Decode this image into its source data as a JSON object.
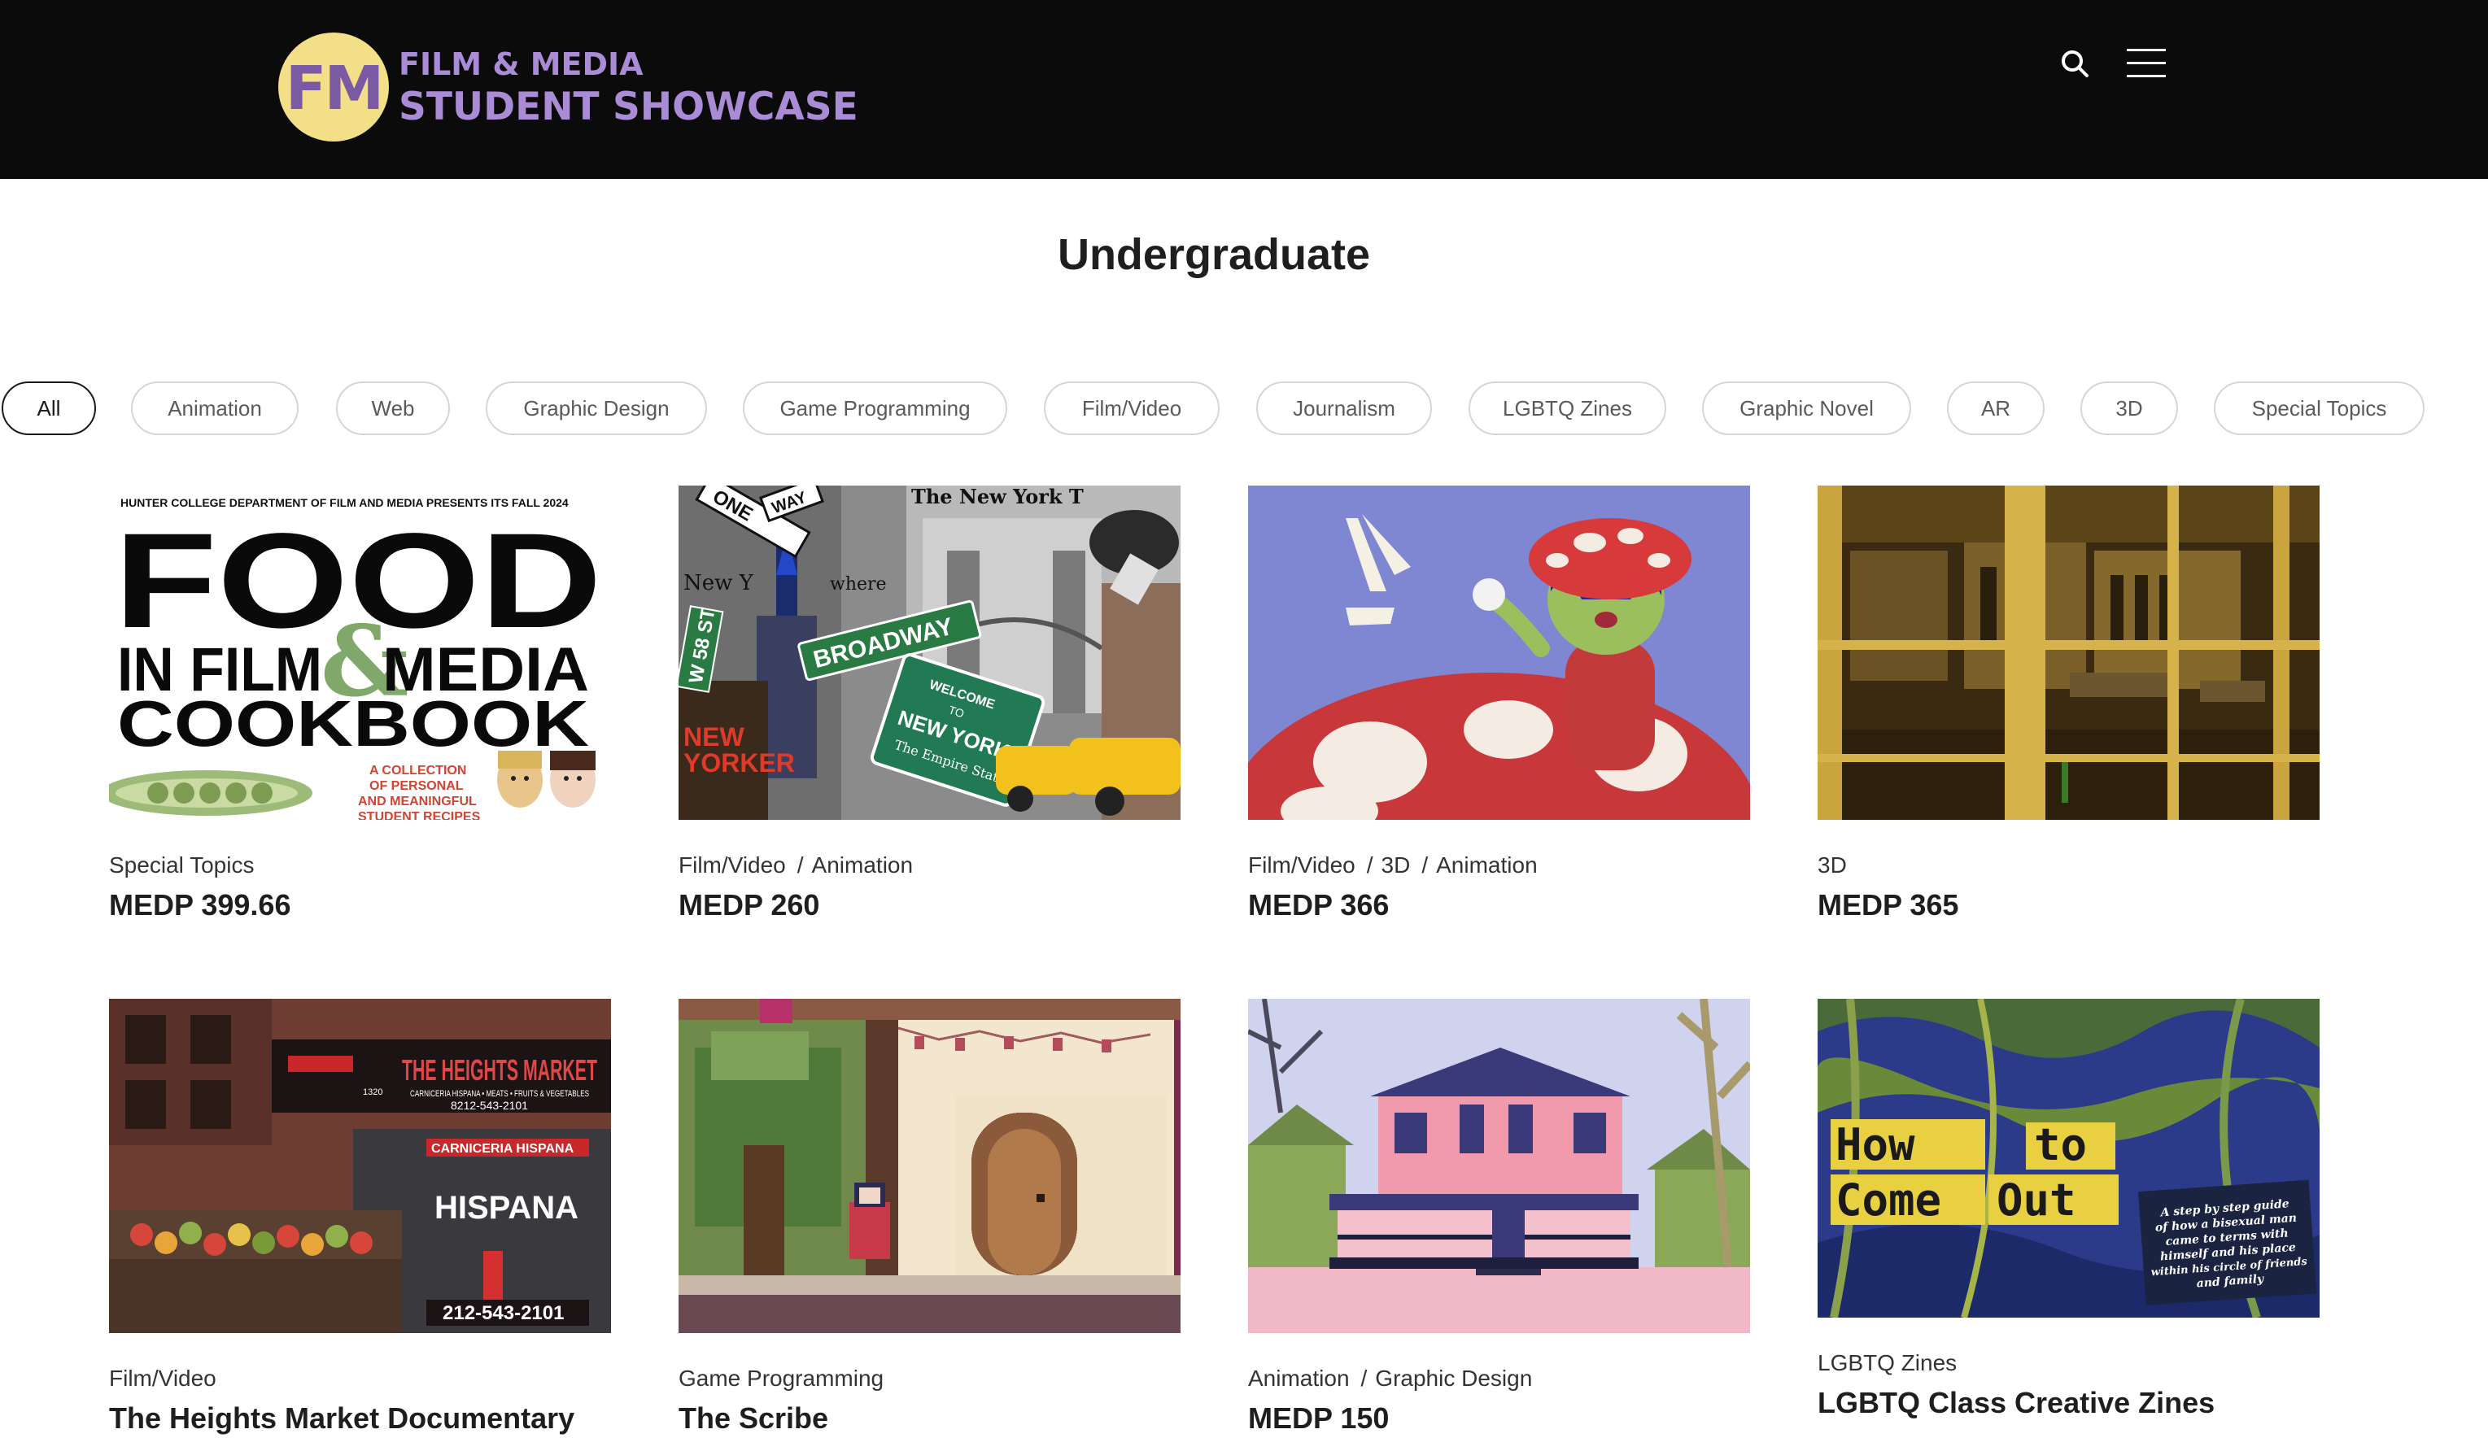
{
  "brand": {
    "logo_letters": "FM",
    "line1": "FILM & MEDIA",
    "line2": "STUDENT SHOWCASE"
  },
  "page": {
    "title": "Undergraduate"
  },
  "filters": [
    "All",
    "Animation",
    "Web",
    "Graphic Design",
    "Game Programming",
    "Film/Video",
    "Journalism",
    "LGBTQ Zines",
    "Graphic Novel",
    "AR",
    "3D",
    "Special Topics"
  ],
  "active_filter": "All",
  "projects": [
    {
      "categories": [
        "Special Topics"
      ],
      "title": "MEDP 399.66",
      "image_text": {
        "header": "HUNTER COLLEGE DEPARTMENT OF FILM AND MEDIA PRESENTS ITS FALL 2024",
        "big": "FOOD",
        "mid_left": "IN FILM",
        "amp": "&",
        "mid_right": "MEDIA",
        "bottom": "COOKBOOK",
        "caption_1": "A COLLECTION",
        "caption_2": "OF PERSONAL",
        "caption_3": "AND MEANINGFUL",
        "caption_4": "STUDENT RECIPES"
      }
    },
    {
      "categories": [
        "Film/Video",
        "Animation"
      ],
      "title": "MEDP 260",
      "image_text": {
        "sign_broadway": "BROADWAY",
        "sign_way": "WAY",
        "sign_one": "ONE",
        "sign_58": "W 58 ST",
        "new_yorker_1": "NEW",
        "new_yorker_2": "YORKER",
        "welcome": "WELCOME",
        "to": "TO",
        "new_york": "NEW YORK",
        "empire": "The Empire State",
        "nyt": "The New York T",
        "new_y": "New Y",
        "where": "where"
      }
    },
    {
      "categories": [
        "Film/Video",
        "3D",
        "Animation"
      ],
      "title": "MEDP 366"
    },
    {
      "categories": [
        "3D"
      ],
      "title": "MEDP 365"
    },
    {
      "categories": [
        "Film/Video"
      ],
      "title": "The Heights Market Documentary",
      "image_text": {
        "store": "THE HEIGHTS MARKET",
        "sub": "CARNICERIA HISPANA • MEATS • FRUITS & VEGETABLES",
        "phone_top": "8212-543-2101",
        "carniceria": "CARNICERIA HISPANA",
        "hispana": "HISPANA",
        "phone": "212-543-2101",
        "num": "1320"
      }
    },
    {
      "categories": [
        "Game Programming"
      ],
      "title": "The Scribe"
    },
    {
      "categories": [
        "Animation",
        "Graphic Design"
      ],
      "title": "MEDP 150"
    },
    {
      "categories": [
        "LGBTQ Zines"
      ],
      "title": "LGBTQ Class Creative Zines",
      "image_text": {
        "how": "How",
        "to": "to",
        "come": "Come",
        "out": "Out",
        "blurb_1": "A step by step guide",
        "blurb_2": "of how a bisexual man",
        "blurb_3": "came to terms with",
        "blurb_4": "himself and his place",
        "blurb_5": "within his circle of friends",
        "blurb_6": "and family"
      }
    }
  ]
}
